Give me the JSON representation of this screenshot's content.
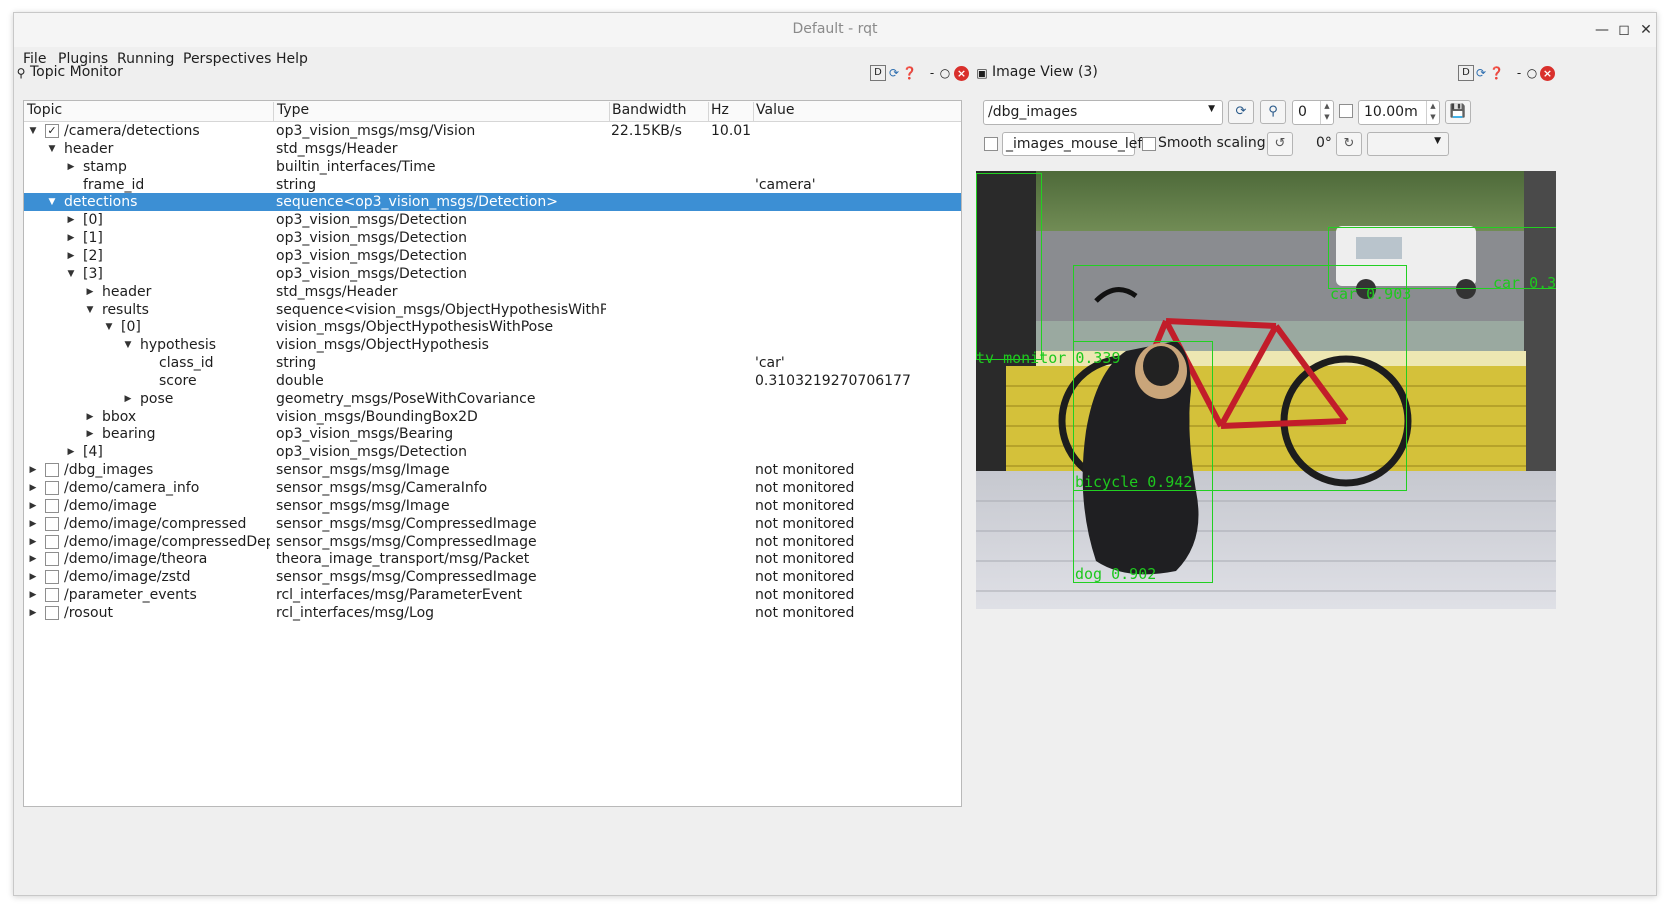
{
  "window": {
    "title": "Default - rqt"
  },
  "menu": {
    "file": "File",
    "plugins": "Plugins",
    "running": "Running",
    "perspectives": "Perspectives",
    "help": "Help"
  },
  "topic_monitor": {
    "title": "Topic Monitor",
    "columns": {
      "topic": "Topic",
      "type": "Type",
      "bandwidth": "Bandwidth",
      "hz": "Hz",
      "value": "Value"
    },
    "rows": [
      {
        "name": "/camera/detections",
        "type": "op3_vision_msgs/msg/Vision",
        "bandwidth": "22.15KB/s",
        "hz": "10.01",
        "value": "",
        "depth": 0,
        "expander": "open",
        "checkbox": "checked"
      },
      {
        "name": "header",
        "type": "std_msgs/Header",
        "bandwidth": "",
        "hz": "",
        "value": "",
        "depth": 1,
        "expander": "open",
        "checkbox": "none"
      },
      {
        "name": "stamp",
        "type": "builtin_interfaces/Time",
        "bandwidth": "",
        "hz": "",
        "value": "",
        "depth": 2,
        "expander": "closed",
        "checkbox": "none"
      },
      {
        "name": "frame_id",
        "type": "string",
        "bandwidth": "",
        "hz": "",
        "value": "'camera'",
        "depth": 2,
        "expander": "none",
        "checkbox": "none"
      },
      {
        "name": "detections",
        "type": "sequence<op3_vision_msgs/Detection>",
        "bandwidth": "",
        "hz": "",
        "value": "",
        "depth": 1,
        "expander": "open",
        "checkbox": "none",
        "selected": true
      },
      {
        "name": "[0]",
        "type": "op3_vision_msgs/Detection",
        "bandwidth": "",
        "hz": "",
        "value": "",
        "depth": 2,
        "expander": "closed",
        "checkbox": "none"
      },
      {
        "name": "[1]",
        "type": "op3_vision_msgs/Detection",
        "bandwidth": "",
        "hz": "",
        "value": "",
        "depth": 2,
        "expander": "closed",
        "checkbox": "none"
      },
      {
        "name": "[2]",
        "type": "op3_vision_msgs/Detection",
        "bandwidth": "",
        "hz": "",
        "value": "",
        "depth": 2,
        "expander": "closed",
        "checkbox": "none"
      },
      {
        "name": "[3]",
        "type": "op3_vision_msgs/Detection",
        "bandwidth": "",
        "hz": "",
        "value": "",
        "depth": 2,
        "expander": "open",
        "checkbox": "none"
      },
      {
        "name": "header",
        "type": "std_msgs/Header",
        "bandwidth": "",
        "hz": "",
        "value": "",
        "depth": 3,
        "expander": "closed",
        "checkbox": "none"
      },
      {
        "name": "results",
        "type": "sequence<vision_msgs/ObjectHypothesisWithPose>",
        "bandwidth": "",
        "hz": "",
        "value": "",
        "depth": 3,
        "expander": "open",
        "checkbox": "none"
      },
      {
        "name": "[0]",
        "type": "vision_msgs/ObjectHypothesisWithPose",
        "bandwidth": "",
        "hz": "",
        "value": "",
        "depth": 4,
        "expander": "open",
        "checkbox": "none"
      },
      {
        "name": "hypothesis",
        "type": "vision_msgs/ObjectHypothesis",
        "bandwidth": "",
        "hz": "",
        "value": "",
        "depth": 5,
        "expander": "open",
        "checkbox": "none"
      },
      {
        "name": "class_id",
        "type": "string",
        "bandwidth": "",
        "hz": "",
        "value": "'car'",
        "depth": 6,
        "expander": "none",
        "checkbox": "none"
      },
      {
        "name": "score",
        "type": "double",
        "bandwidth": "",
        "hz": "",
        "value": "0.3103219270706177",
        "depth": 6,
        "expander": "none",
        "checkbox": "none"
      },
      {
        "name": "pose",
        "type": "geometry_msgs/PoseWithCovariance",
        "bandwidth": "",
        "hz": "",
        "value": "",
        "depth": 5,
        "expander": "closed",
        "checkbox": "none"
      },
      {
        "name": "bbox",
        "type": "vision_msgs/BoundingBox2D",
        "bandwidth": "",
        "hz": "",
        "value": "",
        "depth": 3,
        "expander": "closed",
        "checkbox": "none"
      },
      {
        "name": "bearing",
        "type": "op3_vision_msgs/Bearing",
        "bandwidth": "",
        "hz": "",
        "value": "",
        "depth": 3,
        "expander": "closed",
        "checkbox": "none"
      },
      {
        "name": "[4]",
        "type": "op3_vision_msgs/Detection",
        "bandwidth": "",
        "hz": "",
        "value": "",
        "depth": 2,
        "expander": "closed",
        "checkbox": "none"
      },
      {
        "name": "/dbg_images",
        "type": "sensor_msgs/msg/Image",
        "bandwidth": "",
        "hz": "",
        "value": "not monitored",
        "depth": 0,
        "expander": "closed",
        "checkbox": "unchecked"
      },
      {
        "name": "/demo/camera_info",
        "type": "sensor_msgs/msg/CameraInfo",
        "bandwidth": "",
        "hz": "",
        "value": "not monitored",
        "depth": 0,
        "expander": "closed",
        "checkbox": "unchecked"
      },
      {
        "name": "/demo/image",
        "type": "sensor_msgs/msg/Image",
        "bandwidth": "",
        "hz": "",
        "value": "not monitored",
        "depth": 0,
        "expander": "closed",
        "checkbox": "unchecked"
      },
      {
        "name": "/demo/image/compressed",
        "type": "sensor_msgs/msg/CompressedImage",
        "bandwidth": "",
        "hz": "",
        "value": "not monitored",
        "depth": 0,
        "expander": "closed",
        "checkbox": "unchecked"
      },
      {
        "name": "/demo/image/compressedDepth",
        "type": "sensor_msgs/msg/CompressedImage",
        "bandwidth": "",
        "hz": "",
        "value": "not monitored",
        "depth": 0,
        "expander": "closed",
        "checkbox": "unchecked"
      },
      {
        "name": "/demo/image/theora",
        "type": "theora_image_transport/msg/Packet",
        "bandwidth": "",
        "hz": "",
        "value": "not monitored",
        "depth": 0,
        "expander": "closed",
        "checkbox": "unchecked"
      },
      {
        "name": "/demo/image/zstd",
        "type": "sensor_msgs/msg/CompressedImage",
        "bandwidth": "",
        "hz": "",
        "value": "not monitored",
        "depth": 0,
        "expander": "closed",
        "checkbox": "unchecked"
      },
      {
        "name": "/parameter_events",
        "type": "rcl_interfaces/msg/ParameterEvent",
        "bandwidth": "",
        "hz": "",
        "value": "not monitored",
        "depth": 0,
        "expander": "closed",
        "checkbox": "unchecked"
      },
      {
        "name": "/rosout",
        "type": "rcl_interfaces/msg/Log",
        "bandwidth": "",
        "hz": "",
        "value": "not monitored",
        "depth": 0,
        "expander": "closed",
        "checkbox": "unchecked"
      }
    ]
  },
  "image_view": {
    "title": "Image View (3)",
    "topic_select": "/dbg_images",
    "num_value": "0",
    "max_value": "10.00m",
    "mouse_topic": "_images_mouse_left",
    "smooth_label": "Smooth scaling",
    "rotation": "0°",
    "detections": [
      {
        "label": "car 0.903"
      },
      {
        "label": "car 0.3"
      },
      {
        "label": "tv monitor 0.339"
      },
      {
        "label": "bicycle 0.942"
      },
      {
        "label": "dog 0.902"
      }
    ]
  },
  "icons": {
    "topic_monitor": "magnifier-icon",
    "image_view": "image-icon",
    "dock_d": "d-icon",
    "refresh": "refresh-icon",
    "help": "help-icon",
    "float": "float-icon",
    "close": "close-icon"
  },
  "colors": {
    "selection": "#3c8fd4",
    "close": "#d9302c",
    "detection_box": "#22d022"
  }
}
